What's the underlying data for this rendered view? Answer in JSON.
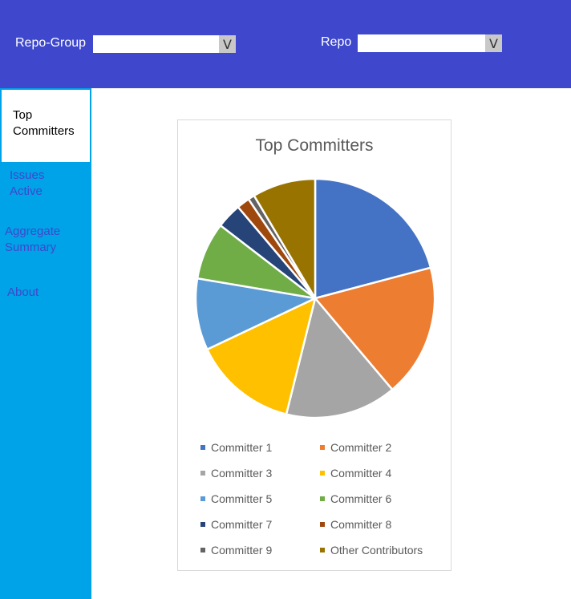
{
  "header": {
    "repo_group_label": "Repo-Group",
    "repo_group_value": "",
    "repo_label": "Repo",
    "repo_value": "",
    "dropdown_arrow": "V"
  },
  "sidebar": {
    "items": [
      {
        "label": "Top Committers",
        "active": true
      },
      {
        "label": "Issues Active",
        "active": false
      },
      {
        "label": "Aggregate Summary",
        "active": false
      },
      {
        "label": "About",
        "active": false
      }
    ]
  },
  "colors": {
    "header_bg": "#3f48cc",
    "sidebar_bg": "#00a2e8",
    "nav_text": "#3f48cc"
  },
  "chart_data": {
    "type": "pie",
    "title": "Top Committers",
    "legend_position": "bottom",
    "slices": [
      {
        "name": "Committer 1",
        "value": 21.5,
        "color": "#4472c4"
      },
      {
        "name": "Committer 2",
        "value": 18.5,
        "color": "#ed7d31"
      },
      {
        "name": "Committer 3",
        "value": 15.5,
        "color": "#a5a5a5"
      },
      {
        "name": "Committer 4",
        "value": 14.5,
        "color": "#ffc000"
      },
      {
        "name": "Committer 5",
        "value": 10.0,
        "color": "#5b9bd5"
      },
      {
        "name": "Committer 6",
        "value": 8.0,
        "color": "#70ad47"
      },
      {
        "name": "Committer 7",
        "value": 3.5,
        "color": "#264478"
      },
      {
        "name": "Committer 8",
        "value": 1.8,
        "color": "#9e480e"
      },
      {
        "name": "Committer 9",
        "value": 0.9,
        "color": "#636363"
      },
      {
        "name": "Other Contributors",
        "value": 8.8,
        "color": "#997300"
      }
    ]
  }
}
